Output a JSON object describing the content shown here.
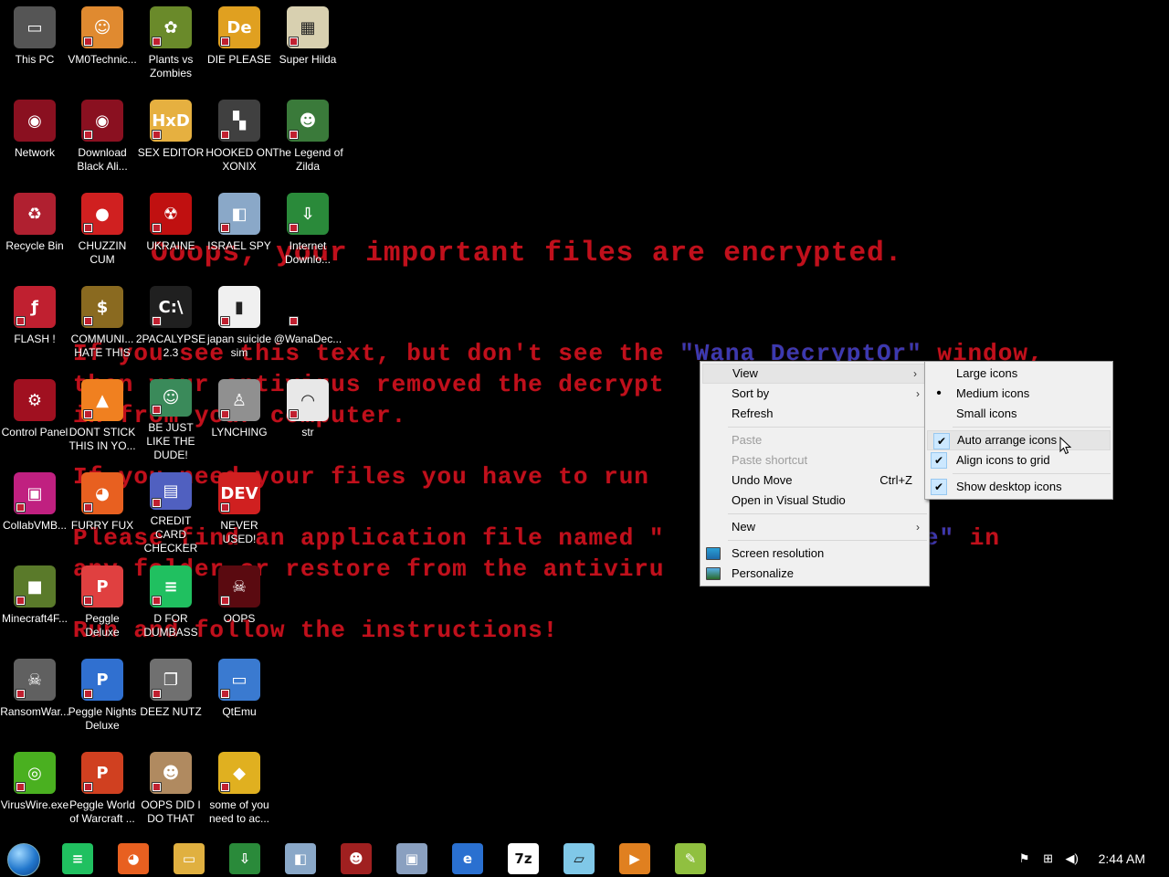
{
  "wallpaper": {
    "line1": "Ooops, your important files are encrypted.",
    "line2a": "If you see this text, but don't see the ",
    "line2b": "\"Wana DecryptOr\"",
    "line2c": " window,",
    "line3": "then your antivirus removed the decrypt",
    "line4": "in from your computer.",
    "line5": "If you need your files you have to run",
    "line6a": "Please find an application file named \"",
    "line6b": "@.exe\"",
    "line6c": " in",
    "line7": "any folder or restore from the antiviru",
    "line8": "Run and follow the instructions!"
  },
  "desktop": {
    "icons": [
      {
        "label": "This PC",
        "color": "#555555",
        "glyph": "▭"
      },
      {
        "label": "VM0Technic...",
        "color": "#e08a30",
        "glyph": "☺"
      },
      {
        "label": "Plants vs Zombies",
        "color": "#6a8a2a",
        "glyph": "✿"
      },
      {
        "label": "DIE PLEASE",
        "color": "#e0a020",
        "glyph": "De"
      },
      {
        "label": "Super Hilda",
        "color": "#d8d0b0",
        "glyph": "▦"
      },
      {
        "label": "Network",
        "color": "#8a1020",
        "glyph": "◉"
      },
      {
        "label": "Download Black Ali...",
        "color": "#8a1020",
        "glyph": "◉"
      },
      {
        "label": "SEX EDITOR",
        "color": "#e6b040",
        "glyph": "HxD"
      },
      {
        "label": "HOOKED ON XONIX",
        "color": "#404040",
        "glyph": "▚"
      },
      {
        "label": "The Legend of Zilda",
        "color": "#3a7a3a",
        "glyph": "☻"
      },
      {
        "label": "Recycle Bin",
        "color": "#b02030",
        "glyph": "♻"
      },
      {
        "label": "CHUZZIN CUM",
        "color": "#d02020",
        "glyph": "●"
      },
      {
        "label": "UKRAINE",
        "color": "#c01010",
        "glyph": "☢"
      },
      {
        "label": "ISRAEL SPY",
        "color": "#8aa8c8",
        "glyph": "◧"
      },
      {
        "label": "Internet Downlo...",
        "color": "#2a8a3a",
        "glyph": "⇩"
      },
      {
        "label": "FLASH !",
        "color": "#c02030",
        "glyph": "ƒ"
      },
      {
        "label": "COMMUNI... HATE THIS",
        "color": "#8a6a20",
        "glyph": "$"
      },
      {
        "label": "2PACALYPSE 2.3",
        "color": "#202020",
        "glyph": "C:\\"
      },
      {
        "label": "japan suicide sim",
        "color": "#f0f0f0",
        "glyph": "▮"
      },
      {
        "label": "@WanaDec...",
        "color": "#000000",
        "glyph": ""
      },
      {
        "label": "Control Panel",
        "color": "#a01020",
        "glyph": "⚙"
      },
      {
        "label": "DONT STICK THIS IN YO...",
        "color": "#f08020",
        "glyph": "▲"
      },
      {
        "label": "BE JUST LIKE THE DUDE!",
        "color": "#3a8a5a",
        "glyph": "☺"
      },
      {
        "label": "LYNCHING",
        "color": "#909090",
        "glyph": "♙"
      },
      {
        "label": "str",
        "color": "#e8e8e8",
        "glyph": "◠"
      },
      {
        "label": "CollabVMB...",
        "color": "#c02080",
        "glyph": "▣"
      },
      {
        "label": "FURRY FUX",
        "color": "#e86020",
        "glyph": "◕"
      },
      {
        "label": "CREDIT CARD CHECKER",
        "color": "#5060c0",
        "glyph": "▤"
      },
      {
        "label": "NEVER USED!",
        "color": "#d02020",
        "glyph": "DEV"
      },
      {
        "label": "",
        "color": "#000000",
        "glyph": ""
      },
      {
        "label": "Minecraft4F...",
        "color": "#5a7a2a",
        "glyph": "■"
      },
      {
        "label": "Peggle Deluxe",
        "color": "#e04040",
        "glyph": "P"
      },
      {
        "label": "D FOR DUMBASS",
        "color": "#20c060",
        "glyph": "≡"
      },
      {
        "label": "OOPS",
        "color": "#5a0a10",
        "glyph": "☠"
      },
      {
        "label": "",
        "color": "#000000",
        "glyph": ""
      },
      {
        "label": "RansomWar...",
        "color": "#606060",
        "glyph": "☠"
      },
      {
        "label": "Peggle Nights Deluxe",
        "color": "#3070d0",
        "glyph": "P"
      },
      {
        "label": "DEEZ NUTZ",
        "color": "#707070",
        "glyph": "❐"
      },
      {
        "label": "QtEmu",
        "color": "#3a7ad0",
        "glyph": "▭"
      },
      {
        "label": "",
        "color": "#000000",
        "glyph": ""
      },
      {
        "label": "VirusWire.exe",
        "color": "#4ab020",
        "glyph": "◎"
      },
      {
        "label": "Peggle World of Warcraft ...",
        "color": "#d04020",
        "glyph": "P"
      },
      {
        "label": "OOPS DID I DO THAT",
        "color": "#b08a60",
        "glyph": "☻"
      },
      {
        "label": "some of you need to ac...",
        "color": "#e0b020",
        "glyph": "◆"
      },
      {
        "label": "",
        "color": "#000000",
        "glyph": ""
      }
    ]
  },
  "context_menu": {
    "items": [
      {
        "label": "View",
        "arrow": "›",
        "state": "highlighted"
      },
      {
        "label": "Sort by",
        "arrow": "›"
      },
      {
        "label": "Refresh"
      },
      {
        "label": "Paste",
        "state": "disabled"
      },
      {
        "label": "Paste shortcut",
        "state": "disabled"
      },
      {
        "label": "Undo Move",
        "shortcut": "Ctrl+Z"
      },
      {
        "label": "Open in Visual Studio"
      },
      {
        "label": "New",
        "arrow": "›"
      },
      {
        "label": "Screen resolution",
        "icon": "display-icon"
      },
      {
        "label": "Personalize",
        "icon": "personalize-icon"
      }
    ]
  },
  "view_submenu": {
    "items": [
      {
        "label": "Large icons"
      },
      {
        "label": "Medium icons",
        "mark": "•"
      },
      {
        "label": "Small icons"
      },
      {
        "label": "Auto arrange icons",
        "mark": "✔",
        "state": "highlighted"
      },
      {
        "label": "Align icons to grid",
        "mark": "✔"
      },
      {
        "label": "Show desktop icons",
        "mark": "✔"
      }
    ]
  },
  "taskbar": {
    "apps": [
      {
        "name": "notes-app",
        "color": "#20c060",
        "glyph": "≡"
      },
      {
        "name": "firefox",
        "color": "#e86020",
        "glyph": "◕"
      },
      {
        "name": "file-explorer",
        "color": "#e0b040",
        "glyph": "▭"
      },
      {
        "name": "internet-download-manager",
        "color": "#2a8a3a",
        "glyph": "⇩"
      },
      {
        "name": "network-tool",
        "color": "#8aa8c8",
        "glyph": "◧"
      },
      {
        "name": "painting-app",
        "color": "#a02020",
        "glyph": "☻"
      },
      {
        "name": "device-manager",
        "color": "#8aa0c0",
        "glyph": "▣"
      },
      {
        "name": "internet-explorer",
        "color": "#2a70d0",
        "glyph": "e"
      },
      {
        "name": "7zip",
        "color": "#ffffff",
        "glyph": "7z"
      },
      {
        "name": "notepad",
        "color": "#80c8e8",
        "glyph": "▱"
      },
      {
        "name": "media-player",
        "color": "#e08020",
        "glyph": "▶"
      },
      {
        "name": "notepad-plus-plus",
        "color": "#90c040",
        "glyph": "✎"
      }
    ],
    "clock": "2:44 AM"
  }
}
